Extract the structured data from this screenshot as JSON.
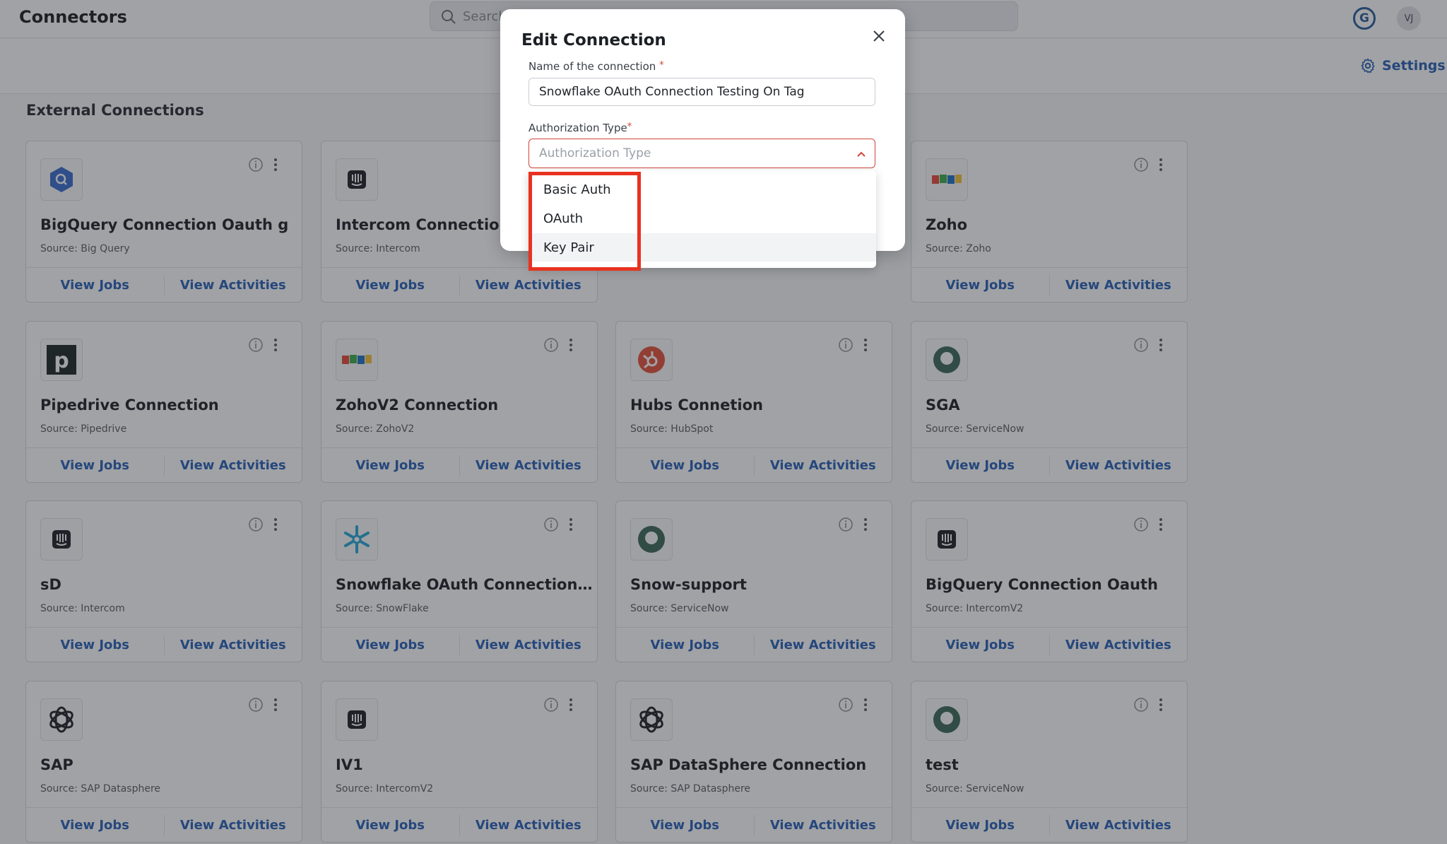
{
  "header": {
    "title": "Connectors",
    "search_placeholder": "Search",
    "g_badge": "G",
    "user_initials": "VJ"
  },
  "subheader": {
    "settings_label": "Settings"
  },
  "section_title": "External Connections",
  "cards": [
    {
      "title": "BigQuery Connection Oauth g",
      "source": "Source: Big Query",
      "logo": "bigquery-icon"
    },
    {
      "title": "Intercom Connection",
      "source": "Source: Intercom",
      "logo": "intercom-icon"
    },
    {
      "title": "",
      "source": "",
      "logo": ""
    },
    {
      "title": "Zoho",
      "source": "Source: Zoho",
      "logo": "zoho-icon"
    },
    {
      "title": "Pipedrive Connection",
      "source": "Source: Pipedrive",
      "logo": "pipedrive-icon"
    },
    {
      "title": "ZohoV2 Connection",
      "source": "Source: ZohoV2",
      "logo": "zoho-icon"
    },
    {
      "title": "Hubs Connetion",
      "source": "Source: HubSpot",
      "logo": "hubspot-icon"
    },
    {
      "title": "SGA",
      "source": "Source: ServiceNow",
      "logo": "servicenow-icon"
    },
    {
      "title": "sD",
      "source": "Source: Intercom",
      "logo": "intercom-icon"
    },
    {
      "title": "Snowflake OAuth Connection Testin...",
      "source": "Source: SnowFlake",
      "logo": "snowflake-icon"
    },
    {
      "title": "Snow-support",
      "source": "Source: ServiceNow",
      "logo": "servicenow-icon"
    },
    {
      "title": "BigQuery Connection Oauth",
      "source": "Source: IntercomV2",
      "logo": "intercom-icon"
    },
    {
      "title": "SAP",
      "source": "Source: SAP Datasphere",
      "logo": "sap-datasphere-icon"
    },
    {
      "title": "IV1",
      "source": "Source: IntercomV2",
      "logo": "intercom-icon"
    },
    {
      "title": "SAP DataSphere Connection",
      "source": "Source: SAP Datasphere",
      "logo": "sap-datasphere-icon"
    },
    {
      "title": "test",
      "source": "Source: ServiceNow",
      "logo": "servicenow-icon"
    }
  ],
  "card_actions": {
    "view_jobs": "View Jobs",
    "view_activities": "View Activities"
  },
  "modal": {
    "title": "Edit Connection",
    "name_label": "Name of the connection",
    "name_value": "Snowflake OAuth Connection Testing On Tag",
    "auth_label": "Authorization Type",
    "required_mark": "*",
    "auth_placeholder": "Authorization Type",
    "auth_options": [
      "Basic Auth",
      "OAuth",
      "Key Pair"
    ]
  },
  "colors": {
    "accent": "#2a62b8",
    "error": "#d1453b",
    "highlight": "#e8321f"
  }
}
